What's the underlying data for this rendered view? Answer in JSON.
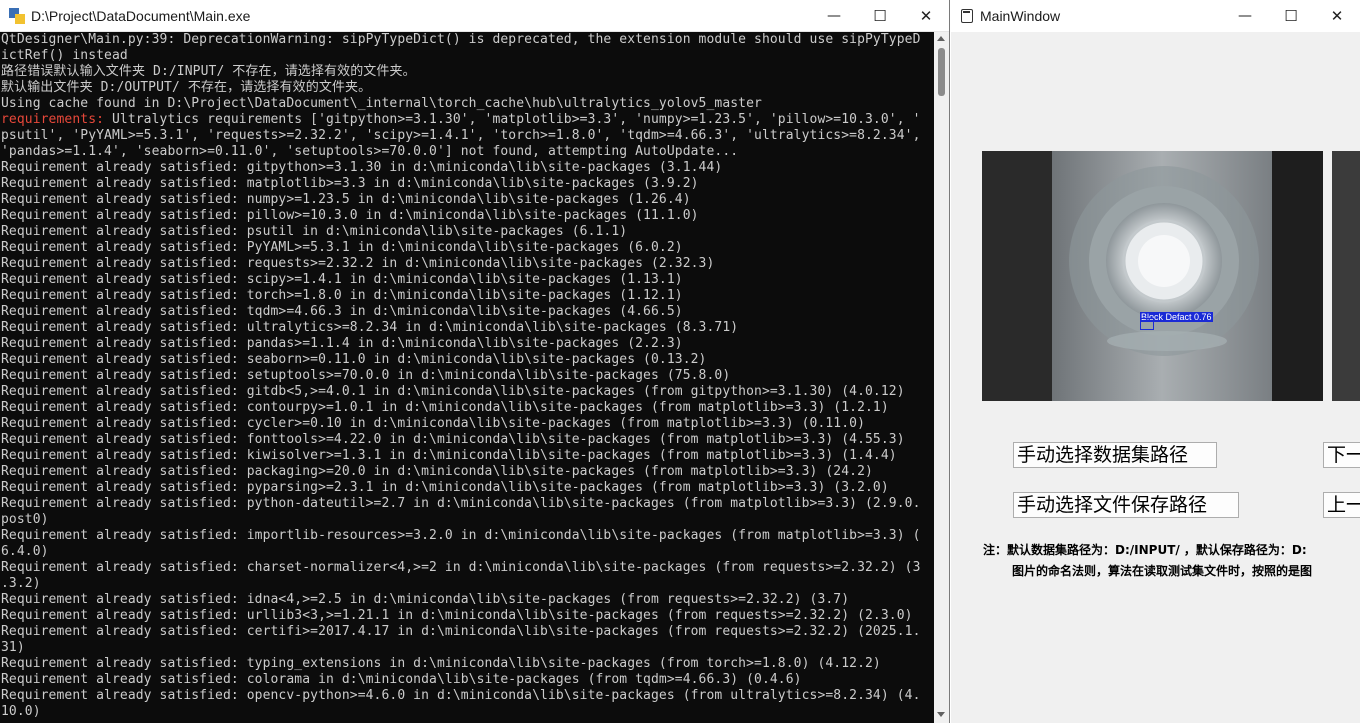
{
  "console": {
    "title": "D:\\Project\\DataDocument\\Main.exe",
    "controls": {
      "minimize": "—",
      "maximize": "☐",
      "close": "✕"
    },
    "lines": [
      "QtDesigner\\Main.py:39: DeprecationWarning: sipPyTypeDict() is deprecated, the extension module should use sipPyTypeD",
      "ictRef() instead",
      "路径错误默认输入文件夹 D:/INPUT/ 不存在，请选择有效的文件夹。",
      "默认输出文件夹 D:/OUTPUT/ 不存在，请选择有效的文件夹。",
      "Using cache found in D:\\Project\\DataDocument\\_internal\\torch_cache\\hub\\ultralytics_yolov5_master",
      "requirements:|| Ultralytics requirements ['gitpython>=3.1.30', 'matplotlib>=3.3', 'numpy>=1.23.5', 'pillow>=10.3.0', '",
      "psutil', 'PyYAML>=5.3.1', 'requests>=2.32.2', 'scipy>=1.4.1', 'torch>=1.8.0', 'tqdm>=4.66.3', 'ultralytics>=8.2.34',",
      "'pandas>=1.1.4', 'seaborn>=0.11.0', 'setuptools>=70.0.0'] not found, attempting AutoUpdate...",
      "Requirement already satisfied: gitpython>=3.1.30 in d:\\miniconda\\lib\\site-packages (3.1.44)",
      "Requirement already satisfied: matplotlib>=3.3 in d:\\miniconda\\lib\\site-packages (3.9.2)",
      "Requirement already satisfied: numpy>=1.23.5 in d:\\miniconda\\lib\\site-packages (1.26.4)",
      "Requirement already satisfied: pillow>=10.3.0 in d:\\miniconda\\lib\\site-packages (11.1.0)",
      "Requirement already satisfied: psutil in d:\\miniconda\\lib\\site-packages (6.1.1)",
      "Requirement already satisfied: PyYAML>=5.3.1 in d:\\miniconda\\lib\\site-packages (6.0.2)",
      "Requirement already satisfied: requests>=2.32.2 in d:\\miniconda\\lib\\site-packages (2.32.3)",
      "Requirement already satisfied: scipy>=1.4.1 in d:\\miniconda\\lib\\site-packages (1.13.1)",
      "Requirement already satisfied: torch>=1.8.0 in d:\\miniconda\\lib\\site-packages (1.12.1)",
      "Requirement already satisfied: tqdm>=4.66.3 in d:\\miniconda\\lib\\site-packages (4.66.5)",
      "Requirement already satisfied: ultralytics>=8.2.34 in d:\\miniconda\\lib\\site-packages (8.3.71)",
      "Requirement already satisfied: pandas>=1.1.4 in d:\\miniconda\\lib\\site-packages (2.2.3)",
      "Requirement already satisfied: seaborn>=0.11.0 in d:\\miniconda\\lib\\site-packages (0.13.2)",
      "Requirement already satisfied: setuptools>=70.0.0 in d:\\miniconda\\lib\\site-packages (75.8.0)",
      "Requirement already satisfied: gitdb<5,>=4.0.1 in d:\\miniconda\\lib\\site-packages (from gitpython>=3.1.30) (4.0.12)",
      "Requirement already satisfied: contourpy>=1.0.1 in d:\\miniconda\\lib\\site-packages (from matplotlib>=3.3) (1.2.1)",
      "Requirement already satisfied: cycler>=0.10 in d:\\miniconda\\lib\\site-packages (from matplotlib>=3.3) (0.11.0)",
      "Requirement already satisfied: fonttools>=4.22.0 in d:\\miniconda\\lib\\site-packages (from matplotlib>=3.3) (4.55.3)",
      "Requirement already satisfied: kiwisolver>=1.3.1 in d:\\miniconda\\lib\\site-packages (from matplotlib>=3.3) (1.4.4)",
      "Requirement already satisfied: packaging>=20.0 in d:\\miniconda\\lib\\site-packages (from matplotlib>=3.3) (24.2)",
      "Requirement already satisfied: pyparsing>=2.3.1 in d:\\miniconda\\lib\\site-packages (from matplotlib>=3.3) (3.2.0)",
      "Requirement already satisfied: python-dateutil>=2.7 in d:\\miniconda\\lib\\site-packages (from matplotlib>=3.3) (2.9.0.",
      "post0)",
      "Requirement already satisfied: importlib-resources>=3.2.0 in d:\\miniconda\\lib\\site-packages (from matplotlib>=3.3) (",
      "6.4.0)",
      "Requirement already satisfied: charset-normalizer<4,>=2 in d:\\miniconda\\lib\\site-packages (from requests>=2.32.2) (3",
      ".3.2)",
      "Requirement already satisfied: idna<4,>=2.5 in d:\\miniconda\\lib\\site-packages (from requests>=2.32.2) (3.7)",
      "Requirement already satisfied: urllib3<3,>=1.21.1 in d:\\miniconda\\lib\\site-packages (from requests>=2.32.2) (2.3.0)",
      "Requirement already satisfied: certifi>=2017.4.17 in d:\\miniconda\\lib\\site-packages (from requests>=2.32.2) (2025.1.",
      "31)",
      "Requirement already satisfied: typing_extensions in d:\\miniconda\\lib\\site-packages (from torch>=1.8.0) (4.12.2)",
      "Requirement already satisfied: colorama in d:\\miniconda\\lib\\site-packages (from tqdm>=4.66.3) (0.4.6)",
      "Requirement already satisfied: opencv-python>=4.6.0 in d:\\miniconda\\lib\\site-packages (from ultralytics>=8.2.34) (4.",
      "10.0)"
    ]
  },
  "main_window": {
    "title": "MainWindow",
    "controls": {
      "minimize": "—",
      "maximize": "☐",
      "close": "✕"
    },
    "detection_label": "Block Defact 0.76",
    "buttons": {
      "dataset": "手动选择数据集路径",
      "save": "手动选择文件保存路径",
      "next": "下一",
      "prev": "上一"
    },
    "note_line1": "注：默认数据集路径为：D:/INPUT/  ，默认保存路径为：D:",
    "note_line2": "图片的命名法则，算法在读取测试集文件时，按照的是图"
  },
  "colors": {
    "console_bg": "#0c0c0c",
    "console_text": "#cccccc",
    "requirements_prefix": "#e8483a",
    "detect_box": "#1a2ad6",
    "window_bg": "#f0f0f0"
  }
}
